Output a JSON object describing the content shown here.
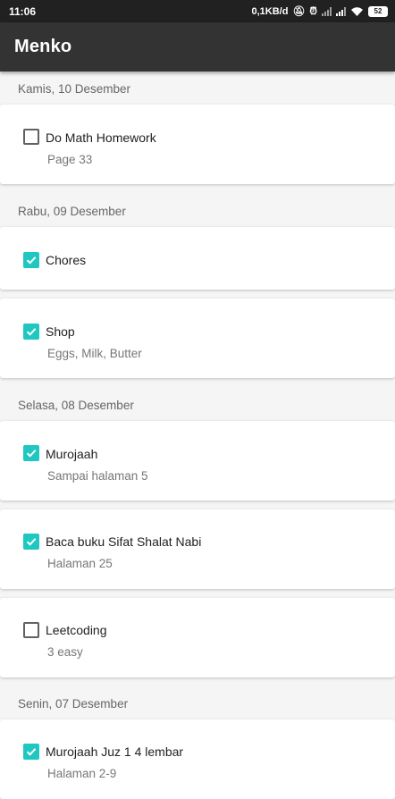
{
  "status_bar": {
    "time": "11:06",
    "speed": "0,1KB/d",
    "battery": "52"
  },
  "app": {
    "title": "Menko",
    "accent_color": "#1ec8c0",
    "appbar_color": "#333333"
  },
  "groups": [
    {
      "date": "Kamis, 10 Desember",
      "tasks": [
        {
          "title": "Do Math Homework",
          "note": "Page 33",
          "checked": false
        }
      ]
    },
    {
      "date": "Rabu, 09 Desember",
      "tasks": [
        {
          "title": "Chores",
          "note": "",
          "checked": true
        },
        {
          "title": "Shop",
          "note": "Eggs, Milk, Butter",
          "checked": true
        }
      ]
    },
    {
      "date": "Selasa, 08 Desember",
      "tasks": [
        {
          "title": "Murojaah",
          "note": "Sampai halaman 5",
          "checked": true
        },
        {
          "title": "Baca buku Sifat Shalat Nabi",
          "note": "Halaman 25",
          "checked": true
        },
        {
          "title": "Leetcoding",
          "note": "3 easy",
          "checked": false
        }
      ]
    },
    {
      "date": "Senin, 07 Desember",
      "tasks": [
        {
          "title": "Murojaah Juz 1 4 lembar",
          "note": "Halaman 2-9",
          "checked": true
        }
      ]
    }
  ]
}
